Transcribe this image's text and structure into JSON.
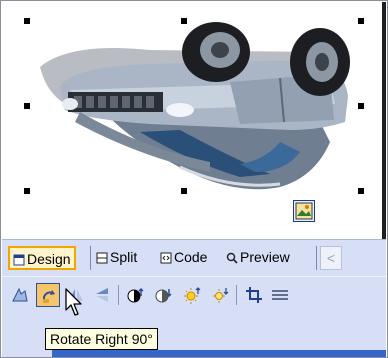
{
  "view_tabs": {
    "design": "Design",
    "split": "Split",
    "code": "Code",
    "preview": "Preview"
  },
  "toolbar": {
    "tools": [
      "edit-image-icon",
      "rotate-right-icon",
      "flip-horizontal-icon",
      "flip-vertical-icon",
      "more-contrast-icon",
      "less-contrast-icon",
      "more-brightness-icon",
      "less-brightness-icon",
      "crop-icon",
      "resample-icon"
    ]
  },
  "tooltip": {
    "text": "Rotate Right 90°"
  },
  "colors": {
    "tab_bar": "#d6dff5",
    "active_tool": "#f6c46a",
    "active_tab_border": "#f2a400",
    "tooltip_bg": "#ffffe1"
  }
}
